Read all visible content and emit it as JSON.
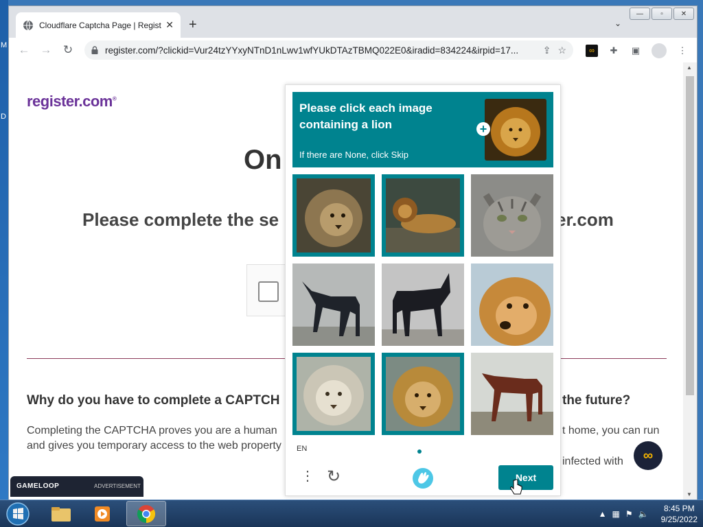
{
  "browser": {
    "tab_title": "Cloudflare Captcha Page | Regist",
    "new_tab": "+",
    "tab_close": "✕",
    "url": "register.com/?clickid=Vur24tzYYxyNTnD1nLwv1wfYUkDTAzTBMQ022E0&iradid=834224&irpid=17...",
    "win_minimize": "—",
    "win_maximize": "▫",
    "win_close": "✕"
  },
  "page": {
    "brand": "register.com",
    "heading_fragment": "On",
    "subheading_left": "Please complete the se",
    "subheading_right": "er.com",
    "why_left": "Why do you have to complete a CAPTCH",
    "why_right": "the future?",
    "body_left_1": "Completing the CAPTCHA proves you are a human",
    "body_left_2": "and gives you temporary access to the web property",
    "body_right_1": "t home, you can run",
    "body_right_2": "infected with",
    "ad_logo": "GAMELOOP",
    "ad_label": "ADVERTISEMENT"
  },
  "captcha": {
    "prompt_title": "Please click each image containing a lion",
    "prompt_sub": "If there are None, click Skip",
    "language": "EN",
    "next_label": "Next",
    "tiles": [
      {
        "subject": "lion",
        "selected": true
      },
      {
        "subject": "lion",
        "selected": true
      },
      {
        "subject": "cat",
        "selected": false
      },
      {
        "subject": "horse",
        "selected": false
      },
      {
        "subject": "horse",
        "selected": false
      },
      {
        "subject": "dog",
        "selected": false
      },
      {
        "subject": "lion",
        "selected": true
      },
      {
        "subject": "lion",
        "selected": true
      },
      {
        "subject": "horse",
        "selected": false
      }
    ]
  },
  "taskbar": {
    "time": "8:45 PM",
    "date": "9/25/2022"
  },
  "desktop_letters": [
    "M",
    "D"
  ]
}
